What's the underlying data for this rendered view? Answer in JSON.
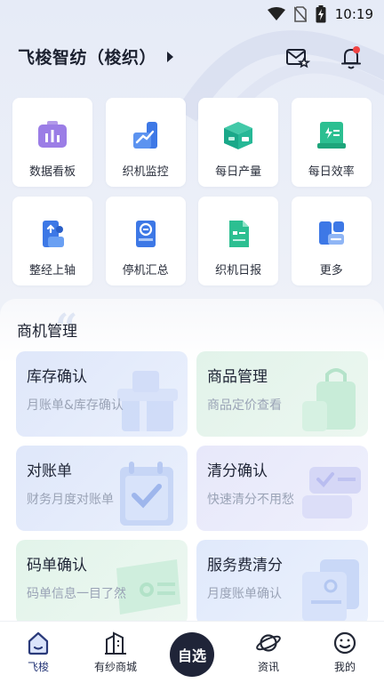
{
  "status_bar": {
    "time": "10:19"
  },
  "header": {
    "company": "飞梭智纺（梭织）"
  },
  "quick_tiles": [
    {
      "label": "数据看板",
      "icon": "dashboard-icon"
    },
    {
      "label": "织机监控",
      "icon": "loom-monitor-icon"
    },
    {
      "label": "每日产量",
      "icon": "daily-output-icon"
    },
    {
      "label": "每日效率",
      "icon": "daily-efficiency-icon"
    },
    {
      "label": "整经上轴",
      "icon": "warping-icon"
    },
    {
      "label": "停机汇总",
      "icon": "downtime-icon"
    },
    {
      "label": "织机日报",
      "icon": "loom-report-icon"
    },
    {
      "label": "更多",
      "icon": "more-icon"
    }
  ],
  "business": {
    "title": "商机管理",
    "cards": [
      {
        "title": "库存确认",
        "subtitle": "月账单&库存确认"
      },
      {
        "title": "商品管理",
        "subtitle": "商品定价查看"
      },
      {
        "title": "对账单",
        "subtitle": "财务月度对账单"
      },
      {
        "title": "清分确认",
        "subtitle": "快速清分不用愁"
      },
      {
        "title": "码单确认",
        "subtitle": "码单信息一目了然"
      },
      {
        "title": "服务费清分",
        "subtitle": "月度账单确认"
      }
    ]
  },
  "bottom_nav": {
    "items": [
      {
        "label": "飞梭"
      },
      {
        "label": "有纱商城"
      },
      {
        "label": "资讯"
      },
      {
        "label": "我的"
      }
    ],
    "center_label": "自选"
  },
  "colors": {
    "accent": "#3d6fe0",
    "nav_dark": "#1f2438",
    "badge": "#f04343"
  }
}
